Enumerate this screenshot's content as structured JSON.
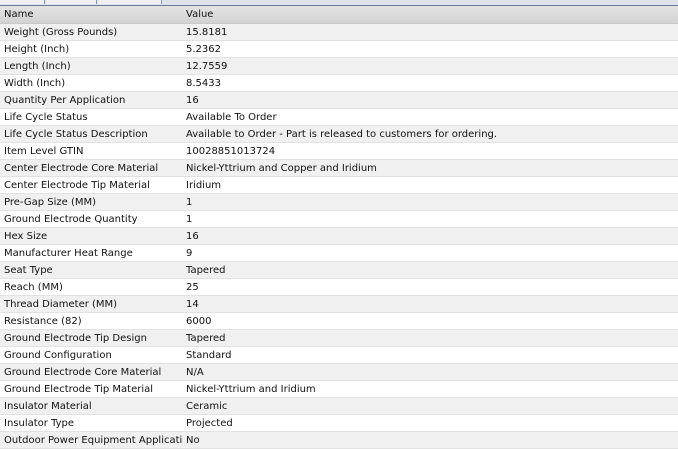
{
  "colors": {
    "header_bg": "#d8d8d8",
    "row_alt": "#f0f0f0",
    "row": "#ffffff"
  },
  "table": {
    "columns": [
      "Name",
      "Value"
    ],
    "rows": [
      [
        "Weight (Gross Pounds)",
        "15.8181"
      ],
      [
        "Height (Inch)",
        "5.2362"
      ],
      [
        "Length (Inch)",
        "12.7559"
      ],
      [
        "Width (Inch)",
        "8.5433"
      ],
      [
        "Quantity Per Application",
        "16"
      ],
      [
        "Life Cycle Status",
        "Available To Order"
      ],
      [
        "Life Cycle Status Description",
        "Available to Order - Part is released to customers for ordering."
      ],
      [
        "Item Level GTIN",
        "10028851013724"
      ],
      [
        "Center Electrode Core Material",
        "Nickel-Yttrium and Copper and Iridium"
      ],
      [
        "Center Electrode Tip Material",
        "Iridium"
      ],
      [
        "Pre-Gap Size (MM)",
        "1"
      ],
      [
        "Ground Electrode Quantity",
        "1"
      ],
      [
        "Hex Size",
        "16"
      ],
      [
        "Manufacturer Heat Range",
        "9"
      ],
      [
        "Seat Type",
        "Tapered"
      ],
      [
        "Reach (MM)",
        "25"
      ],
      [
        "Thread Diameter (MM)",
        "14"
      ],
      [
        "Resistance (82)",
        "6000"
      ],
      [
        "Ground Electrode Tip Design",
        "Tapered"
      ],
      [
        "Ground Configuration",
        "Standard"
      ],
      [
        "Ground Electrode Core Material",
        "N/A"
      ],
      [
        "Ground Electrode Tip Material",
        "Nickel-Yttrium and Iridium"
      ],
      [
        "Insulator Material",
        "Ceramic"
      ],
      [
        "Insulator Type",
        "Projected"
      ],
      [
        "Outdoor Power Equipment Application",
        "No"
      ]
    ]
  }
}
